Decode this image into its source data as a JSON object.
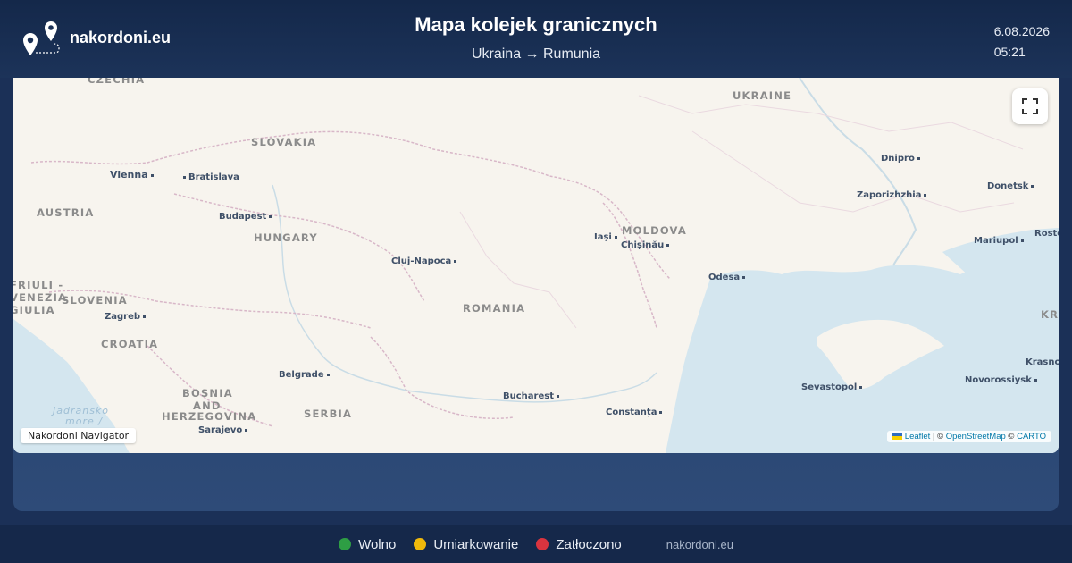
{
  "header": {
    "brand": "nakordoni.eu",
    "title": "Mapa kolejek granicznych",
    "subtitle": "Ukraina → Rumunia",
    "date": "6.08.2026",
    "time": "05:21"
  },
  "map": {
    "countries": [
      "CZECHIA",
      "UKRAINE",
      "SLOVAKIA",
      "AUSTRIA",
      "HUNGARY",
      "MOLDOVA",
      "ROMANIA",
      "SLOVENIA",
      "CROATIA",
      "BOSNIA",
      "AND",
      "HERZEGOVINA",
      "SERBIA",
      "FRIULI -",
      "VENEZIA",
      "GIULIA",
      "KRA"
    ],
    "cities": [
      "Vienna",
      "Bratislava",
      "Budapest",
      "Cluj-Napoca",
      "Iași",
      "Chișinău",
      "Odesa",
      "Dnipro",
      "Zaporizhzhia",
      "Donetsk",
      "Mariupol",
      "Rosto",
      "Zagreb",
      "Belgrade",
      "Sarajevo",
      "Bucharest",
      "Constanța",
      "Sevastopol",
      "Novorossiysk",
      "Krasnod"
    ],
    "sea": [
      "Jadransko",
      "more /"
    ],
    "fullscreen_icon": "fullscreen-icon",
    "nav_label": "Nakordoni Navigator",
    "attribution": {
      "flag_icon": "ukraine-flag-icon",
      "leaflet": "Leaflet",
      "sep1": " | © ",
      "osm": "OpenStreetMap",
      "sep2": " © ",
      "carto": "CARTO"
    }
  },
  "legend": [
    {
      "label": "Wolno",
      "color": "#2e9e44"
    },
    {
      "label": "Umiarkowanie",
      "color": "#f0b90b"
    },
    {
      "label": "Zatłoczono",
      "color": "#d9343f"
    }
  ],
  "footer": {
    "site": "nakordoni.eu"
  }
}
